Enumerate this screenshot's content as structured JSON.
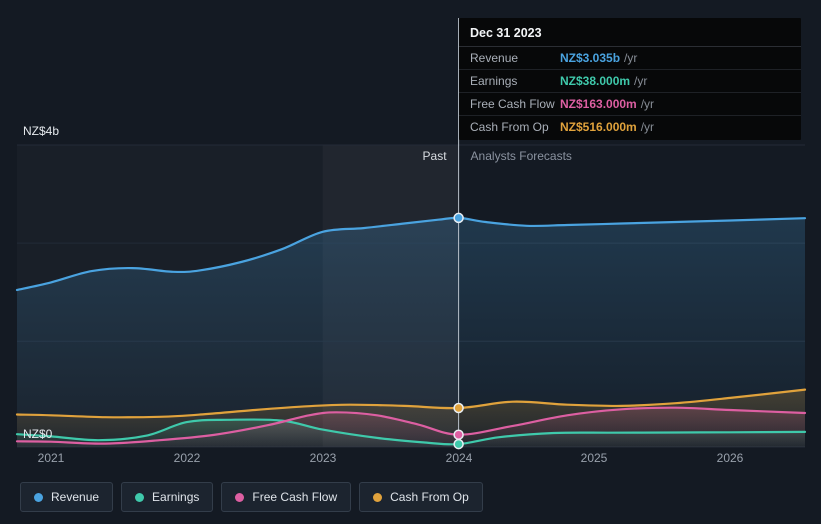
{
  "axis": {
    "y_top_label": "NZ$4b",
    "y_bottom_label": "NZ$0",
    "x_ticks": [
      "2021",
      "2022",
      "2023",
      "2024",
      "2025",
      "2026"
    ],
    "past_label": "Past",
    "forecast_label": "Analysts Forecasts"
  },
  "tooltip": {
    "date": "Dec 31 2023",
    "rows": [
      {
        "label": "Revenue",
        "value": "NZ$3.035b",
        "suffix": "/yr",
        "color": "#4aa3e0"
      },
      {
        "label": "Earnings",
        "value": "NZ$38.000m",
        "suffix": "/yr",
        "color": "#3fc9ab"
      },
      {
        "label": "Free Cash Flow",
        "value": "NZ$163.000m",
        "suffix": "/yr",
        "color": "#dd5fa2"
      },
      {
        "label": "Cash From Op",
        "value": "NZ$516.000m",
        "suffix": "/yr",
        "color": "#e0a23c"
      }
    ]
  },
  "legend": [
    {
      "label": "Revenue",
      "color": "#4aa3e0"
    },
    {
      "label": "Earnings",
      "color": "#3fc9ab"
    },
    {
      "label": "Free Cash Flow",
      "color": "#dd5fa2"
    },
    {
      "label": "Cash From Op",
      "color": "#e0a23c"
    }
  ],
  "chart_data": {
    "type": "line",
    "title": "Earnings and Revenue History with Analyst Forecasts",
    "unit": "NZ$ millions per year",
    "x_range": [
      2020.75,
      2026.55
    ],
    "ylim": [
      0,
      4000
    ],
    "grid_values": [
      4000,
      2700,
      1400,
      0
    ],
    "divider_x": 2024,
    "divider_date": "Dec 31 2023",
    "highlight_band": [
      2023,
      2024
    ],
    "past_region": [
      2020.75,
      2024
    ],
    "legend_position": "bottom",
    "series": [
      {
        "name": "Revenue",
        "color": "#4aa3e0",
        "x": [
          2020.75,
          2021.0,
          2021.3,
          2021.6,
          2021.9,
          2022.1,
          2022.4,
          2022.7,
          2023.0,
          2023.3,
          2023.6,
          2023.85,
          2024.0,
          2024.2,
          2024.5,
          2024.8,
          2025.2,
          2025.6,
          2026.0,
          2026.55
        ],
        "values": [
          2080,
          2180,
          2330,
          2370,
          2320,
          2340,
          2450,
          2620,
          2850,
          2900,
          2960,
          3010,
          3035,
          2980,
          2930,
          2940,
          2960,
          2980,
          3000,
          3030
        ]
      },
      {
        "name": "Earnings",
        "color": "#3fc9ab",
        "x": [
          2020.75,
          2021.0,
          2021.35,
          2021.7,
          2022.0,
          2022.3,
          2022.7,
          2023.0,
          2023.4,
          2023.75,
          2024.0,
          2024.3,
          2024.7,
          2025.1,
          2025.6,
          2026.0,
          2026.55
        ],
        "values": [
          170,
          140,
          90,
          150,
          330,
          360,
          350,
          230,
          120,
          60,
          38,
          130,
          185,
          190,
          192,
          195,
          200
        ]
      },
      {
        "name": "Free Cash Flow",
        "color": "#dd5fa2",
        "x": [
          2020.75,
          2021.0,
          2021.4,
          2021.8,
          2022.2,
          2022.6,
          2022.9,
          2023.1,
          2023.4,
          2023.7,
          2024.0,
          2024.4,
          2024.8,
          2025.2,
          2025.6,
          2026.0,
          2026.55
        ],
        "values": [
          75,
          70,
          45,
          90,
          160,
          290,
          420,
          460,
          420,
          300,
          163,
          280,
          420,
          500,
          520,
          490,
          450
        ]
      },
      {
        "name": "Cash From Op",
        "color": "#e0a23c",
        "x": [
          2020.75,
          2021.0,
          2021.4,
          2021.8,
          2022.1,
          2022.5,
          2022.9,
          2023.2,
          2023.6,
          2024.0,
          2024.4,
          2024.8,
          2025.2,
          2025.6,
          2026.0,
          2026.55
        ],
        "values": [
          430,
          420,
          395,
          400,
          430,
          490,
          540,
          560,
          545,
          516,
          600,
          560,
          545,
          580,
          650,
          760
        ]
      }
    ],
    "markers": [
      {
        "series": "Revenue",
        "x": 2024,
        "value": 3035
      },
      {
        "series": "Earnings",
        "x": 2024,
        "value": 38
      },
      {
        "series": "Free Cash Flow",
        "x": 2024,
        "value": 163
      },
      {
        "series": "Cash From Op",
        "x": 2024,
        "value": 516
      }
    ]
  }
}
